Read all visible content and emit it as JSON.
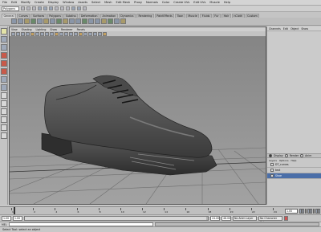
{
  "menubar": [
    "File",
    "Edit",
    "Modify",
    "Create",
    "Display",
    "Window",
    "Assets",
    "Select",
    "Mesh",
    "Edit Mesh",
    "Proxy",
    "Normals",
    "Color",
    "Create UVs",
    "Edit UVs",
    "Muscle",
    "Help"
  ],
  "status": {
    "mode": "Polygons"
  },
  "shelf_tabs": [
    "General",
    "Curves",
    "Surfaces",
    "Polygons",
    "Subdivs",
    "Deformation",
    "Animation",
    "Dynamics",
    "Rendering",
    "PaintEffects",
    "Toon",
    "Muscle",
    "Fluids",
    "Fur",
    "Hair",
    "nCloth",
    "Custom"
  ],
  "shelf_active": 0,
  "view_menu": [
    "View",
    "Shading",
    "Lighting",
    "Show",
    "Renderer",
    "Panels"
  ],
  "channel_box_header": [
    "Channels",
    "Edit",
    "Object",
    "Show"
  ],
  "layer_tabs": [
    "Display",
    "Render",
    "Anim"
  ],
  "layer_menu": [
    "Layers",
    "Options",
    "Help"
  ],
  "layers": [
    {
      "name": "DT_curves",
      "selected": false
    },
    {
      "name": "text",
      "selected": false
    },
    {
      "name": "Shoe",
      "selected": true
    }
  ],
  "timeline": {
    "ticks": [
      "1",
      "2",
      "4",
      "6",
      "8",
      "10",
      "12",
      "14",
      "16",
      "18",
      "20",
      "22",
      "24"
    ],
    "current_frame": "1.00"
  },
  "range": {
    "start": "1.00",
    "start_inner": "1.00",
    "end_inner": "24.00",
    "end": "48.00",
    "anim_layer": "No Anim Layer",
    "char_set": "No Character Set"
  },
  "command": {
    "label": "MEL"
  },
  "help_line": "Select Tool: select an object"
}
